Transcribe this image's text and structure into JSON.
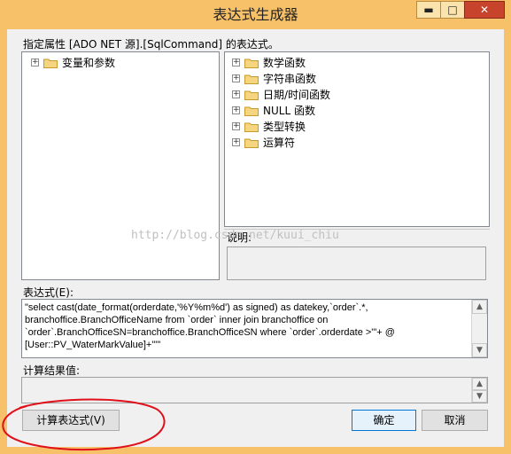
{
  "window": {
    "title": "表达式生成器",
    "controls": {
      "minimize": "▬",
      "maximize": "□",
      "close": "✕"
    }
  },
  "property_label": "指定属性 [ADO NET 源].[SqlCommand] 的表达式。",
  "variables_tree": {
    "items": [
      {
        "label": "变量和参数",
        "expander": "+",
        "icon": "folder-icon"
      }
    ]
  },
  "functions_tree": {
    "items": [
      {
        "label": "数学函数",
        "expander": "+",
        "icon": "folder-icon"
      },
      {
        "label": "字符串函数",
        "expander": "+",
        "icon": "folder-icon"
      },
      {
        "label": "日期/时间函数",
        "expander": "+",
        "icon": "folder-icon"
      },
      {
        "label": "NULL 函数",
        "expander": "+",
        "icon": "folder-icon"
      },
      {
        "label": "类型转换",
        "expander": "+",
        "icon": "folder-icon"
      },
      {
        "label": "运算符",
        "expander": "+",
        "icon": "folder-icon"
      }
    ]
  },
  "description": {
    "label": "说明:",
    "text": ""
  },
  "watermark": "http://blog.csdn.net/kuui_chiu",
  "expression": {
    "label": "表达式(E):",
    "lines": [
      "\"select    cast(date_format(orderdate,'%Y%m%d') as signed) as datekey,`order`.*,",
      "branchoffice.BranchOfficeName  from `order` inner join branchoffice on",
      "`order`.BranchOfficeSN=branchoffice.BranchOfficeSN where `order`.orderdate >'\"+  @",
      "[User::PV_WaterMarkValue]+\"'\""
    ]
  },
  "result": {
    "label": "计算结果值:",
    "value": ""
  },
  "buttons": {
    "evaluate": "计算表达式(V)",
    "ok": "确定",
    "cancel": "取消"
  },
  "scroll_glyphs": {
    "up": "▲",
    "down": "▼"
  },
  "annotation_color": "#e0101a",
  "title_bar_color": "#f7c16a"
}
